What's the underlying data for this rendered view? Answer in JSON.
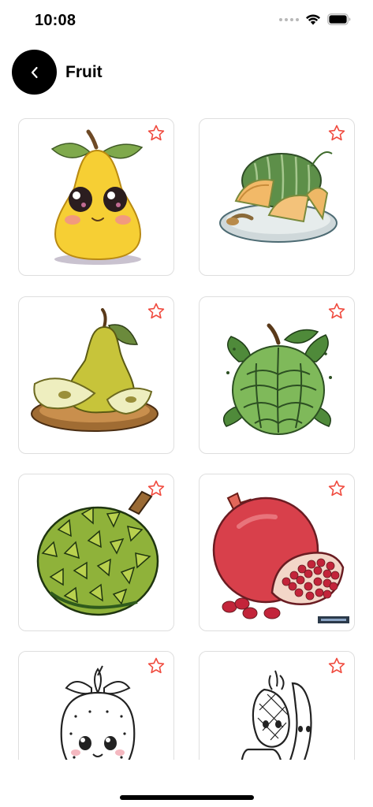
{
  "status_bar": {
    "time": "10:08"
  },
  "header": {
    "title": "Fruit"
  },
  "cards": [
    {
      "name": "kawaii-pear"
    },
    {
      "name": "cantaloupe-melon"
    },
    {
      "name": "pear-on-plate"
    },
    {
      "name": "custard-apple"
    },
    {
      "name": "durian"
    },
    {
      "name": "pomegranate"
    },
    {
      "name": "strawberry-outline"
    },
    {
      "name": "banana-pineapple-outline"
    }
  ],
  "colors": {
    "star": "#f04a3e",
    "card_border": "#dedede"
  }
}
